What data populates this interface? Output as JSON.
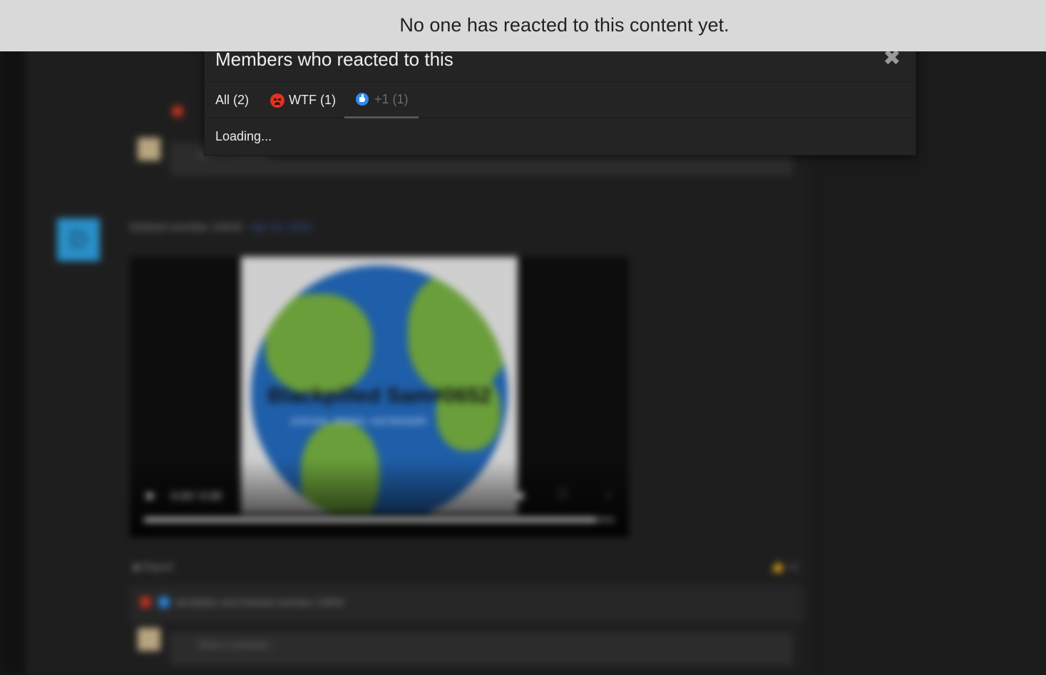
{
  "notice": {
    "message": "No one has reacted to this content yet."
  },
  "dialog": {
    "title": "Members who reacted to this",
    "close_glyph": "✖",
    "tabs": [
      {
        "label": "All (2)",
        "icon": null,
        "active": false
      },
      {
        "label": "WTF (1)",
        "icon": "wtf-reaction-icon",
        "active": false
      },
      {
        "label": "+1 (1)",
        "icon": "thumbs-up-reaction-icon",
        "active": true
      }
    ],
    "body_text": "Loading..."
  },
  "background": {
    "post": {
      "avatar_letter": "D",
      "author": "Deleted member 10918",
      "date": "Apr 23, 2022",
      "video_title": "Blackpilled Sam#0652",
      "video_subtitle": "podcasts, debates, and blackpills",
      "video_time": "0:29 / 0:30",
      "video_progress": 0.96,
      "report_label": "Report",
      "like_label": "+1",
      "reactors_text": "devildabs and Deleted member 10604",
      "comment_placeholder": "Write a comment..."
    },
    "colors": {
      "accent_blue": "#2a8fc7",
      "date_link": "#3a56a8"
    }
  }
}
